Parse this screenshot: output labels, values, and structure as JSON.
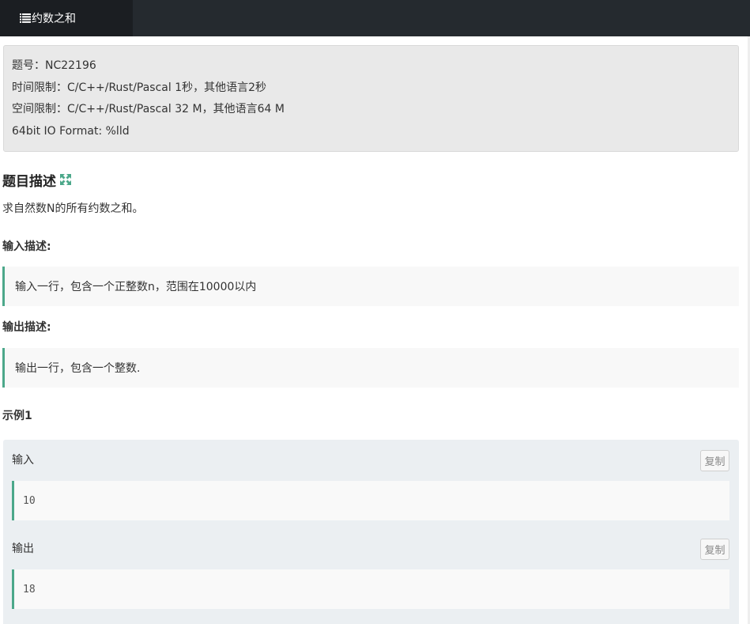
{
  "topbar": {
    "title": "约数之和",
    "icon": "list-icon"
  },
  "info": {
    "lines": [
      "题号：NC22196",
      "时间限制：C/C++/Rust/Pascal 1秒，其他语言2秒",
      "空间限制：C/C++/Rust/Pascal 32 M，其他语言64 M",
      "64bit IO Format: %lld"
    ]
  },
  "problem": {
    "heading": "题目描述",
    "expand_icon": "expand-icon",
    "description": "求自然数N的所有约数之和。"
  },
  "input_section": {
    "title": "输入描述:",
    "content": "输入一行，包含一个正整数n，范围在10000以内"
  },
  "output_section": {
    "title": "输出描述:",
    "content": "输出一行，包含一个整数."
  },
  "example": {
    "title": "示例1",
    "input_label": "输入",
    "input_value": "10",
    "output_label": "输出",
    "output_value": "18",
    "copy_label": "复制"
  },
  "colors": {
    "accent": "#4ca88a",
    "topbar": "#252a2f",
    "topbar_tab": "#1b1e22"
  }
}
